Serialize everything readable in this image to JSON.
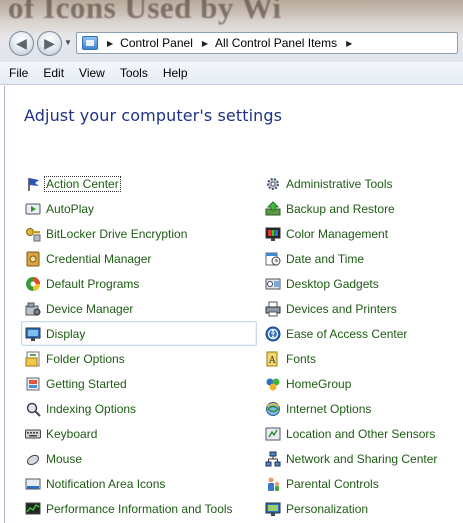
{
  "window": {
    "background_caption": "of Icons Used by Wi"
  },
  "address": {
    "crumbs": [
      "Control Panel",
      "All Control Panel Items"
    ]
  },
  "menu": [
    "File",
    "Edit",
    "View",
    "Tools",
    "Help"
  ],
  "page": {
    "heading": "Adjust your computer's settings"
  },
  "items_left": [
    {
      "label": "Action Center",
      "icon": "flag-icon"
    },
    {
      "label": "AutoPlay",
      "icon": "autoplay-icon"
    },
    {
      "label": "BitLocker Drive Encryption",
      "icon": "key-lock-icon"
    },
    {
      "label": "Credential Manager",
      "icon": "vault-icon"
    },
    {
      "label": "Default Programs",
      "icon": "default-programs-icon"
    },
    {
      "label": "Device Manager",
      "icon": "device-manager-icon"
    },
    {
      "label": "Display",
      "icon": "monitor-icon"
    },
    {
      "label": "Folder Options",
      "icon": "folder-options-icon"
    },
    {
      "label": "Getting Started",
      "icon": "getting-started-icon"
    },
    {
      "label": "Indexing Options",
      "icon": "indexing-icon"
    },
    {
      "label": "Keyboard",
      "icon": "keyboard-icon"
    },
    {
      "label": "Mouse",
      "icon": "mouse-icon"
    },
    {
      "label": "Notification Area Icons",
      "icon": "notification-area-icon"
    },
    {
      "label": "Performance Information and Tools",
      "icon": "performance-icon"
    }
  ],
  "items_right": [
    {
      "label": "Administrative Tools",
      "icon": "admin-tools-icon"
    },
    {
      "label": "Backup and Restore",
      "icon": "backup-icon"
    },
    {
      "label": "Color Management",
      "icon": "color-management-icon"
    },
    {
      "label": "Date and Time",
      "icon": "date-time-icon"
    },
    {
      "label": "Desktop Gadgets",
      "icon": "gadgets-icon"
    },
    {
      "label": "Devices and Printers",
      "icon": "printer-icon"
    },
    {
      "label": "Ease of Access Center",
      "icon": "ease-of-access-icon"
    },
    {
      "label": "Fonts",
      "icon": "fonts-icon"
    },
    {
      "label": "HomeGroup",
      "icon": "homegroup-icon"
    },
    {
      "label": "Internet Options",
      "icon": "internet-options-icon"
    },
    {
      "label": "Location and Other Sensors",
      "icon": "sensors-icon"
    },
    {
      "label": "Network and Sharing Center",
      "icon": "network-icon"
    },
    {
      "label": "Parental Controls",
      "icon": "parental-controls-icon"
    },
    {
      "label": "Personalization",
      "icon": "personalization-icon"
    }
  ],
  "colors": {
    "link_green": "#1e5b14",
    "heading_blue": "#1e3287",
    "hover_border": "#c9d9ee"
  }
}
